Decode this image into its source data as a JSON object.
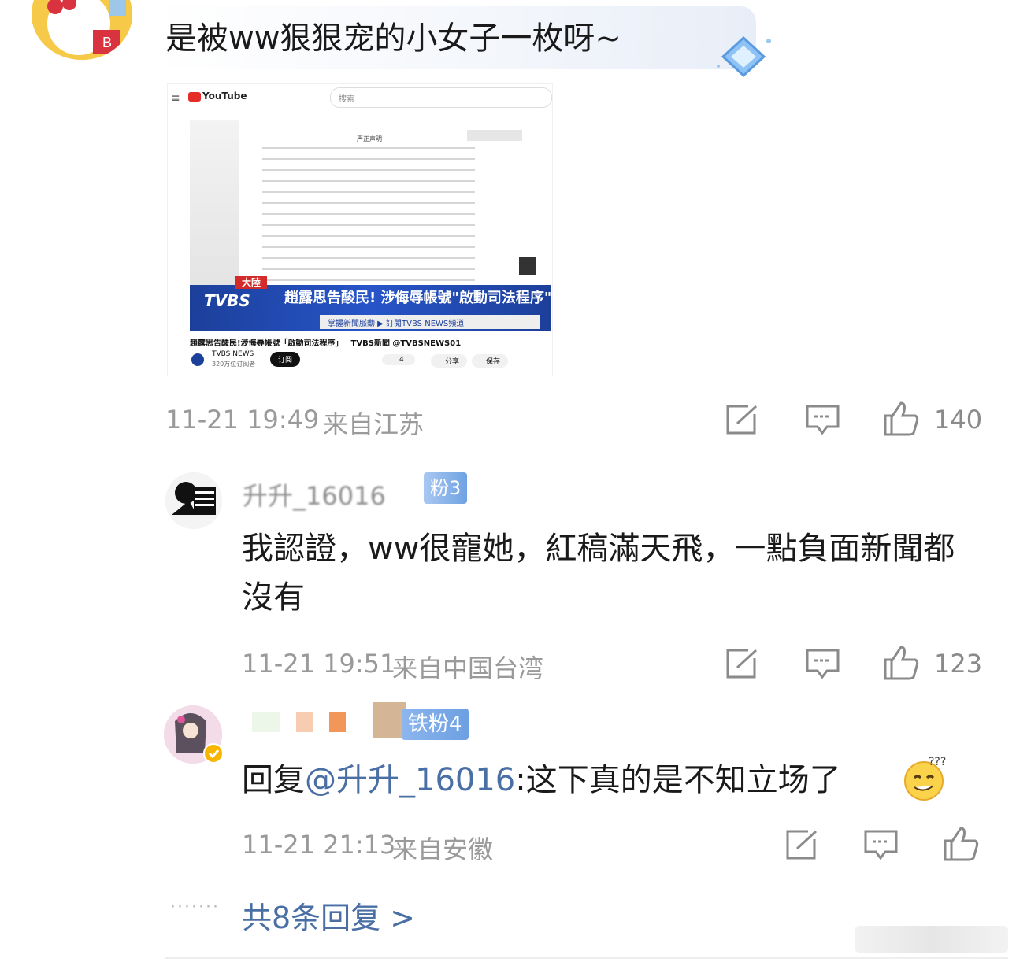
{
  "post": {
    "text": "是被ww狠狠宠的小女子一枚呀~",
    "embed": {
      "site": "YouTube",
      "search_placeholder": "搜索",
      "doc_title": "严正声明",
      "banner_tag": "大陸",
      "banner_title": "趙露思告酸民! 涉侮辱帳號\"啟動司法程序\"",
      "banner_sub": "掌握新聞脈動 ▶ 訂閱TVBS NEWS頻道",
      "video_title": "趙露思告酸民!涉侮辱帳號「啟動司法程序」｜TVBS新聞 @TVBSNEWS01",
      "channel": "TVBS NEWS",
      "subscribers": "320万位订阅者",
      "subscribe_btn": "订阅",
      "like_count": "4",
      "share": "分享",
      "save": "保存"
    },
    "time": "11-21 19:49",
    "location": "来自江苏",
    "likes": "140"
  },
  "replies": [
    {
      "username": "升升_16016",
      "badge": "粉3",
      "text": "我認證，ww很寵她，紅稿滿天飛，一點負面新聞都沒有",
      "time": "11-21 19:51",
      "location": "来自中国台湾",
      "likes": "123"
    },
    {
      "username": "",
      "badge": "铁粉4",
      "reply_prefix": "回复",
      "mention": "@升升_16016",
      "text": ":这下真的是不知立场了",
      "time": "11-21 21:13",
      "location": "来自安徽",
      "likes": ""
    }
  ],
  "more_replies": "共8条回复 >",
  "colors": {
    "link": "#4a6fa5",
    "meta": "#9a9a9a",
    "badge_blue": "#7aa8e8"
  }
}
